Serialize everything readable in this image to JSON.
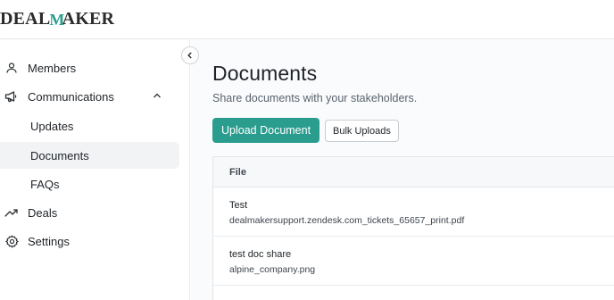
{
  "brand": {
    "part1": "DEAL",
    "accent": "M",
    "part2": "AKER",
    "accent_color": "#2a9d8f"
  },
  "sidebar": {
    "items": [
      {
        "label": "Members",
        "icon": "user-icon"
      },
      {
        "label": "Communications",
        "icon": "megaphone-icon",
        "expanded": true,
        "children": [
          {
            "label": "Updates"
          },
          {
            "label": "Documents",
            "active": true
          },
          {
            "label": "FAQs"
          }
        ]
      },
      {
        "label": "Deals",
        "icon": "trending-up-icon"
      },
      {
        "label": "Settings",
        "icon": "gear-icon"
      }
    ]
  },
  "main": {
    "title": "Documents",
    "subtitle": "Share documents with your stakeholders.",
    "upload_label": "Upload Document",
    "bulk_label": "Bulk Uploads",
    "table": {
      "header": "File",
      "rows": [
        {
          "name": "Test",
          "file": "dealmakersupport.zendesk.com_tickets_65657_print.pdf"
        },
        {
          "name": "test doc share",
          "file": "alpine_company.png"
        }
      ]
    }
  },
  "colors": {
    "primary": "#2a9d8f",
    "active_bg": "#f2f3f5"
  }
}
